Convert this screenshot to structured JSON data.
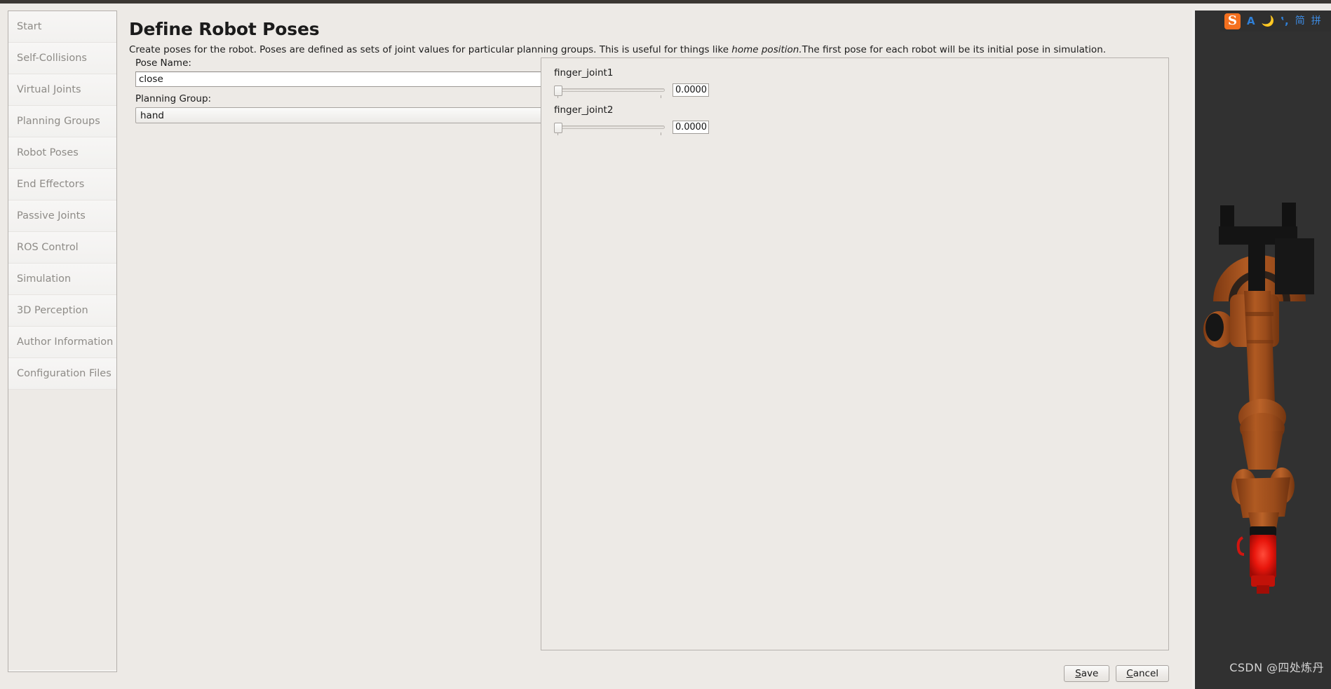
{
  "window": {
    "background_color": "#edeae6",
    "top_strip_color": "#3b3733"
  },
  "sidebar": {
    "items": [
      {
        "label": "Start"
      },
      {
        "label": "Self-Collisions"
      },
      {
        "label": "Virtual Joints"
      },
      {
        "label": "Planning Groups"
      },
      {
        "label": "Robot Poses"
      },
      {
        "label": "End Effectors"
      },
      {
        "label": "Passive Joints"
      },
      {
        "label": "ROS Control"
      },
      {
        "label": "Simulation"
      },
      {
        "label": "3D Perception"
      },
      {
        "label": "Author Information"
      },
      {
        "label": "Configuration Files"
      }
    ]
  },
  "header": {
    "title": "Define Robot Poses",
    "description_part1": "Create poses for the robot. Poses are defined as sets of joint values for particular planning groups. This is useful for things like ",
    "description_emphasis": "home position.",
    "description_part2": "The first pose for each robot will be its initial pose in simulation."
  },
  "form": {
    "pose_name_label": "Pose Name:",
    "pose_name_value": "close",
    "pose_name_placeholder": "",
    "planning_group_label": "Planning Group:",
    "planning_group_value": "hand",
    "planning_group_options": [
      "hand"
    ]
  },
  "joints": [
    {
      "name": "finger_joint1",
      "value": "0.0000",
      "slider_position_percent": 0
    },
    {
      "name": "finger_joint2",
      "value": "0.0000",
      "slider_position_percent": 0
    }
  ],
  "buttons": {
    "save": {
      "accel": "S",
      "rest": "ave"
    },
    "cancel": {
      "accel": "C",
      "rest": "ancel"
    }
  },
  "viewport": {
    "background_color": "#313131",
    "robot_color": "#b4561f",
    "gripper_color": "#e01b10"
  },
  "ime": {
    "logo": "S",
    "mode_letter": "A",
    "moon_icon": "moon-icon",
    "comma_icon": "comma-icon",
    "simplified": "简",
    "pinyin": "拼"
  },
  "watermark": {
    "text": "CSDN @四处炼丹"
  }
}
